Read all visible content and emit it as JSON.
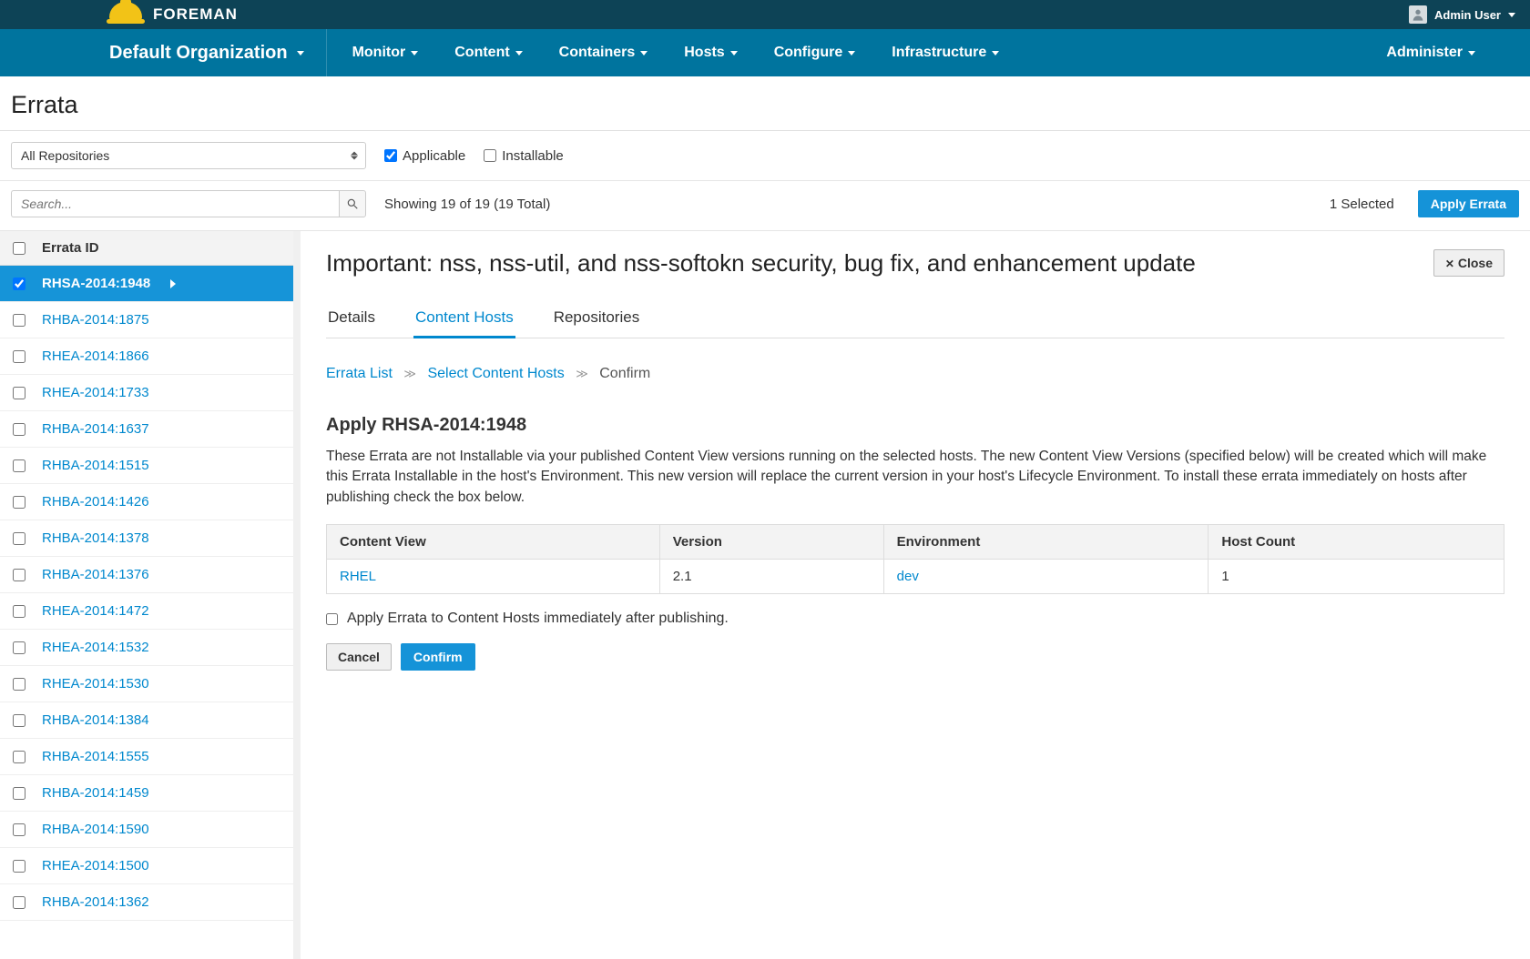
{
  "brand": "FOREMAN",
  "user": {
    "name": "Admin User"
  },
  "org": "Default Organization",
  "nav": {
    "items": [
      "Monitor",
      "Content",
      "Containers",
      "Hosts",
      "Configure",
      "Infrastructure"
    ],
    "admin": "Administer"
  },
  "page": {
    "title": "Errata"
  },
  "filters": {
    "repo_select": "All Repositories",
    "applicable_label": "Applicable",
    "installable_label": "Installable",
    "search_placeholder": "Search...",
    "showing": "Showing 19 of 19 (19 Total)",
    "selected": "1 Selected",
    "apply_button": "Apply Errata"
  },
  "list": {
    "header": "Errata ID",
    "items": [
      {
        "id": "RHSA-2014:1948",
        "active": true,
        "checked": true
      },
      {
        "id": "RHBA-2014:1875"
      },
      {
        "id": "RHEA-2014:1866"
      },
      {
        "id": "RHEA-2014:1733"
      },
      {
        "id": "RHBA-2014:1637"
      },
      {
        "id": "RHBA-2014:1515"
      },
      {
        "id": "RHBA-2014:1426"
      },
      {
        "id": "RHBA-2014:1378"
      },
      {
        "id": "RHBA-2014:1376"
      },
      {
        "id": "RHEA-2014:1472"
      },
      {
        "id": "RHEA-2014:1532"
      },
      {
        "id": "RHEA-2014:1530"
      },
      {
        "id": "RHBA-2014:1384"
      },
      {
        "id": "RHBA-2014:1555"
      },
      {
        "id": "RHBA-2014:1459"
      },
      {
        "id": "RHBA-2014:1590"
      },
      {
        "id": "RHEA-2014:1500"
      },
      {
        "id": "RHBA-2014:1362"
      }
    ]
  },
  "detail": {
    "title": "Important: nss, nss-util, and nss-softokn security, bug fix, and enhancement update",
    "close": "Close",
    "tabs": {
      "details": "Details",
      "content_hosts": "Content Hosts",
      "repositories": "Repositories"
    },
    "crumbs": {
      "errata_list": "Errata List",
      "select_hosts": "Select Content Hosts",
      "confirm": "Confirm"
    },
    "section_heading": "Apply RHSA-2014:1948",
    "explain": "These Errata are not Installable via your published Content View versions running on the selected hosts. The new Content View Versions (specified below) will be created which will make this Errata Installable in the host's Environment. This new version will replace the current version in your host's Lifecycle Environment. To install these errata immediately on hosts after publishing check the box below.",
    "table": {
      "headers": {
        "cv": "Content View",
        "ver": "Version",
        "env": "Environment",
        "hc": "Host Count"
      },
      "row": {
        "cv": "RHEL",
        "ver": "2.1",
        "env": "dev",
        "hc": "1"
      }
    },
    "apply_immediate": "Apply Errata to Content Hosts immediately after publishing.",
    "actions": {
      "cancel": "Cancel",
      "confirm": "Confirm"
    }
  }
}
